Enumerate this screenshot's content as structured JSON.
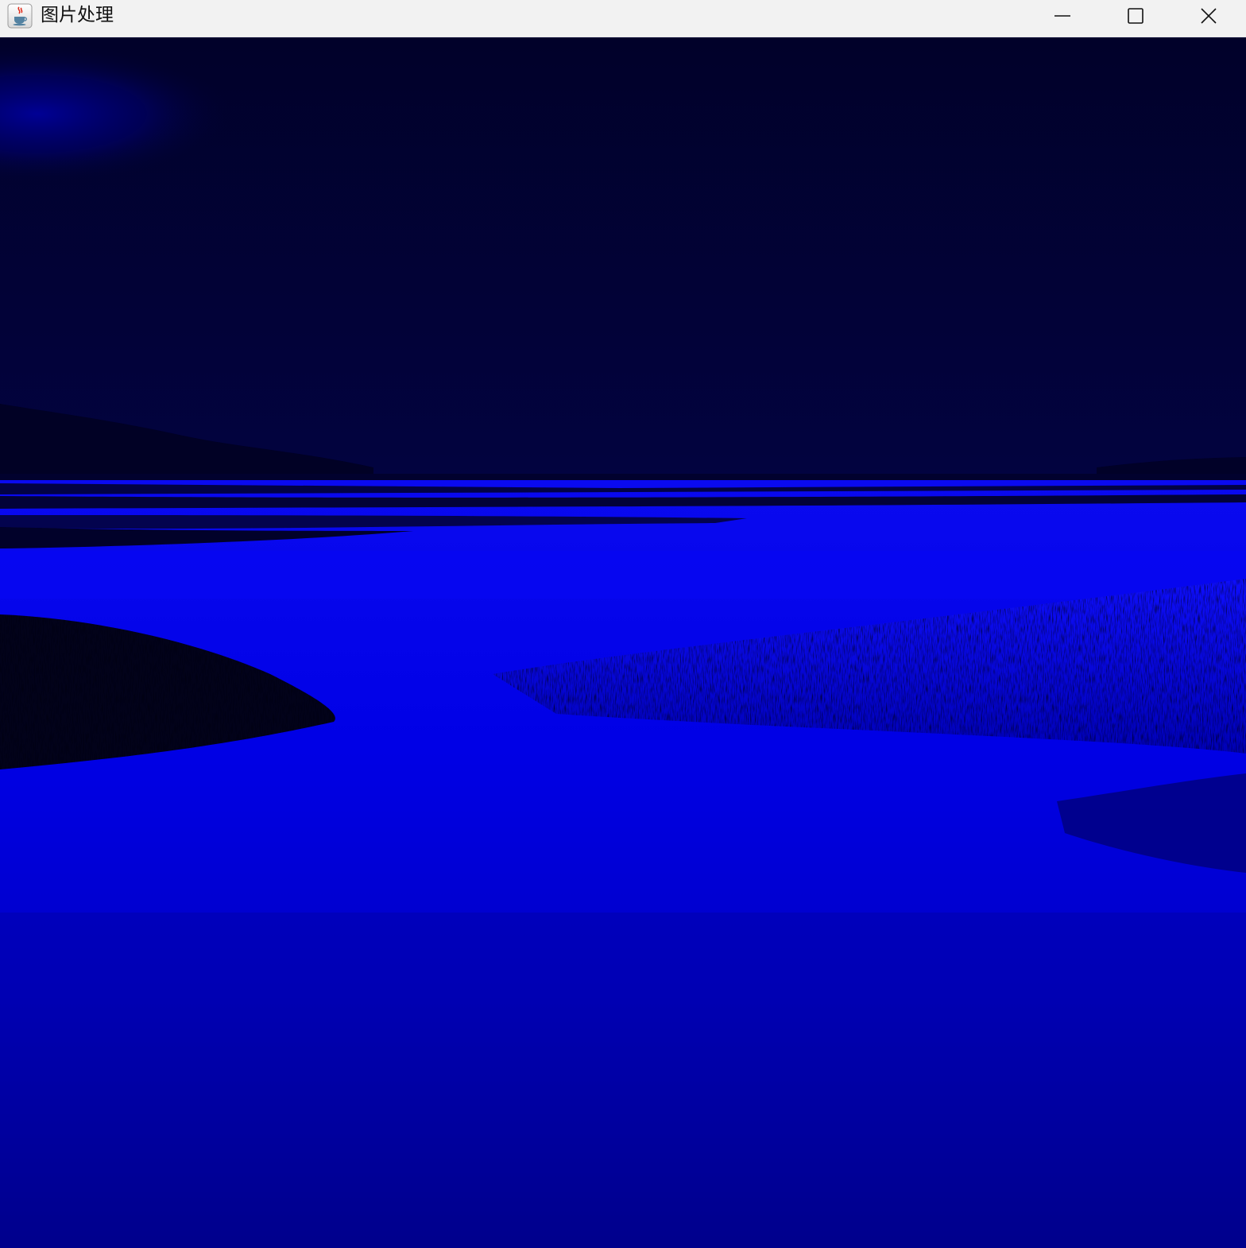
{
  "window": {
    "title": "图片处理",
    "app_icon": "java-coffee-cup-icon",
    "controls": {
      "minimize_icon": "minimize-icon",
      "maximize_icon": "maximize-icon",
      "close_icon": "close-icon"
    }
  },
  "image": {
    "description_icon": "processed-landscape-image",
    "colors": {
      "sky": "#010231",
      "water": "#0000ee",
      "water_deep": "#00009a",
      "shadow": "#00000f"
    }
  }
}
